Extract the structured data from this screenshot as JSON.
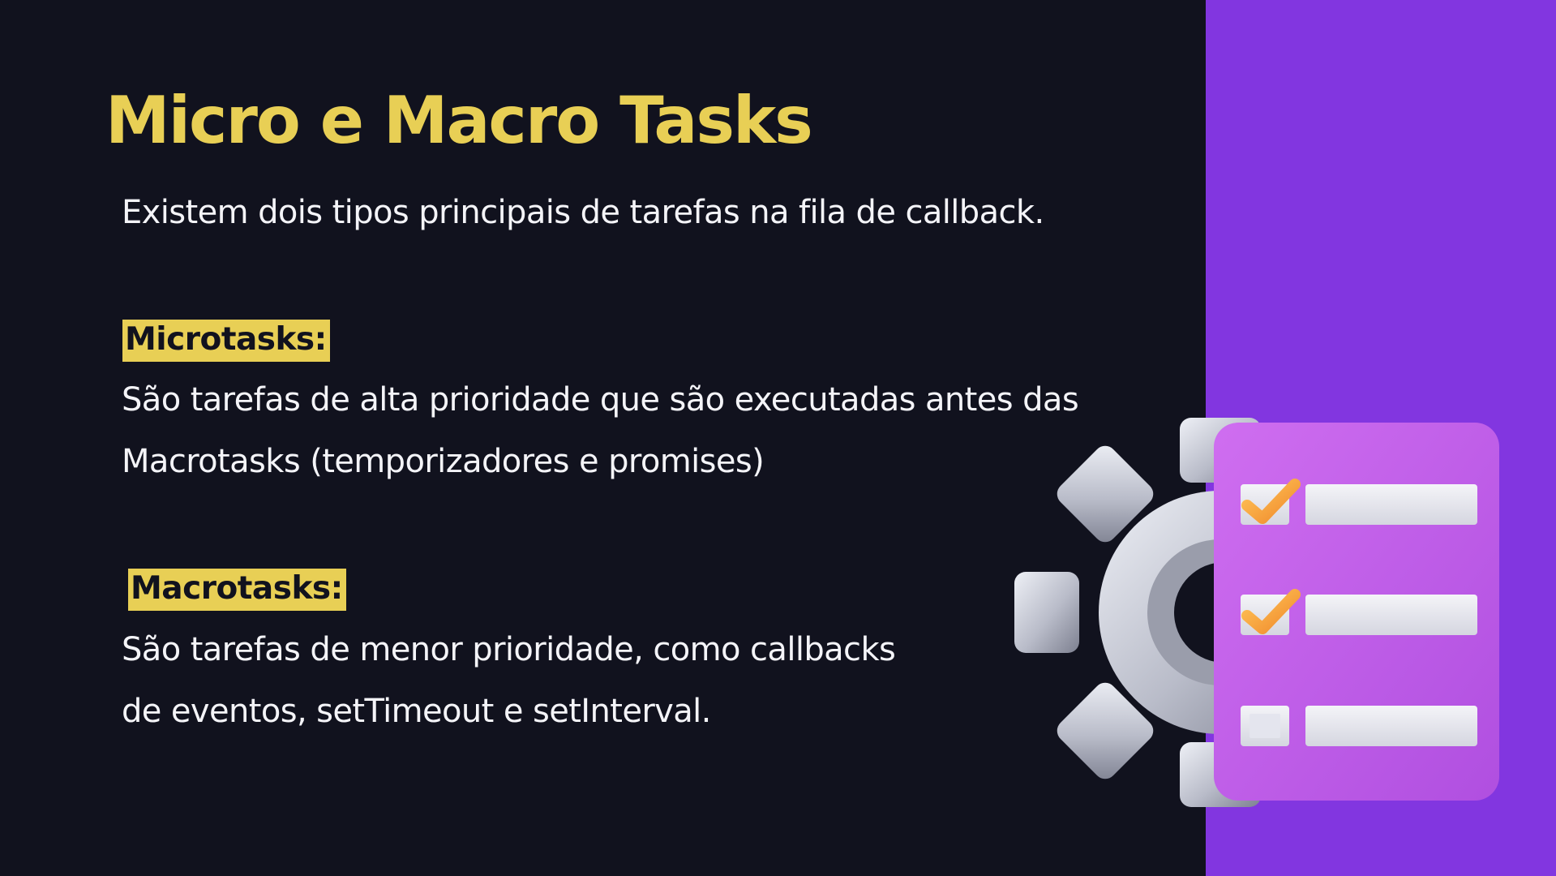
{
  "slide": {
    "title": "Micro e Macro Tasks",
    "intro": "Existem dois tipos principais de tarefas na fila de callback.",
    "microtasks": {
      "label": "Microtasks:",
      "line1": "São tarefas de alta prioridade que são executadas antes das",
      "line2": "Macrotasks (temporizadores e promises)"
    },
    "macrotasks": {
      "label": "Macrotasks:",
      "line1": "São tarefas de menor prioridade, como callbacks",
      "line2": "de eventos, setTimeout e setInterval."
    }
  },
  "illustration": {
    "icon": "gear-checklist-icon",
    "checklist": [
      {
        "checked": true
      },
      {
        "checked": true
      },
      {
        "checked": false
      }
    ]
  },
  "colors": {
    "background": "#11121e",
    "panel": "#8236e0",
    "accent": "#e8cf55",
    "text": "#f4f4f8",
    "card": "#c15fe6"
  }
}
